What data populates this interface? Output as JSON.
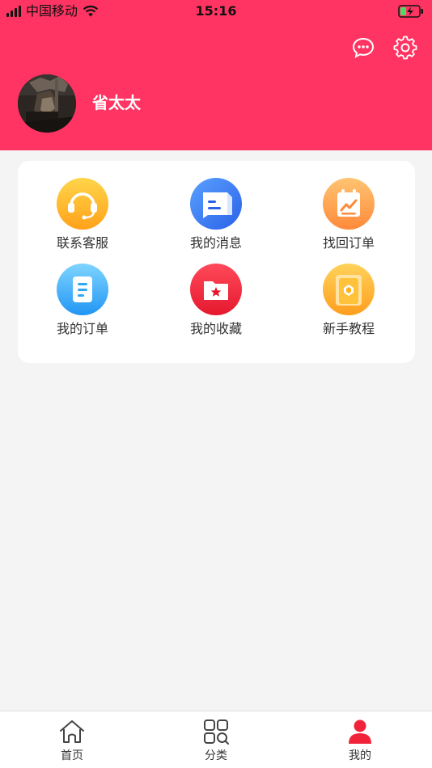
{
  "status_bar": {
    "carrier": "中国移动",
    "time": "15:16"
  },
  "header": {
    "background_color": "#ff3462",
    "message_icon": "chat-bubble-icon",
    "settings_icon": "gear-icon"
  },
  "profile": {
    "username": "省太太"
  },
  "grid": {
    "items": [
      {
        "label": "联系客服",
        "icon": "headset-icon",
        "color": "#ffb321"
      },
      {
        "label": "我的消息",
        "icon": "message-icon",
        "color": "#3b7cf0"
      },
      {
        "label": "找回订单",
        "icon": "retrieve-order-icon",
        "color": "#ff9f4a"
      },
      {
        "label": "我的订单",
        "icon": "order-list-icon",
        "color": "#2ea8f5"
      },
      {
        "label": "我的收藏",
        "icon": "favorites-folder-icon",
        "color": "#f0233a"
      },
      {
        "label": "新手教程",
        "icon": "tutorial-icon",
        "color": "#ffb321"
      }
    ]
  },
  "tabbar": {
    "items": [
      {
        "label": "首页",
        "icon": "home-icon",
        "active": false
      },
      {
        "label": "分类",
        "icon": "category-icon",
        "active": false
      },
      {
        "label": "我的",
        "icon": "profile-icon",
        "active": true
      }
    ],
    "active_color": "#f0233a"
  }
}
